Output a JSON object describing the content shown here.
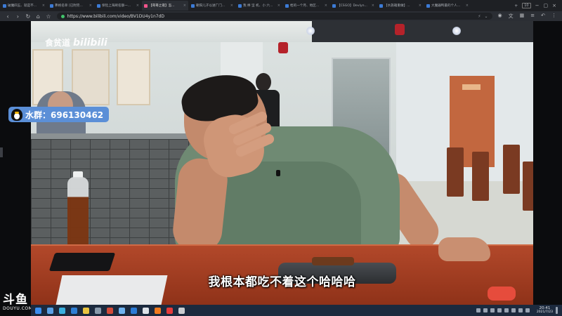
{
  "browser": {
    "tabs": [
      {
        "title": "破魔四五、就是不..."
      },
      {
        "title": "弗格名单 [已附完..."
      },
      {
        "title": "保险上海刷名额一..."
      },
      {
        "title": "【哥哥之夜】怎..."
      },
      {
        "title": "朝阳儿子以进厂门..."
      },
      {
        "title": "我 棒 坚 机、小 六..."
      },
      {
        "title": "枪的一个月、地区..."
      },
      {
        "title": "【CSGO】Devlyn..."
      },
      {
        "title": "【水族箱重做】..."
      },
      {
        "title": "大魔器鸭最的个人..."
      }
    ],
    "tab_count": "10",
    "url": "https://www.bilibili.com/video/BV1DU4y1n7dD"
  },
  "video": {
    "watermark_channel": "食贫道",
    "watermark_logo": "bilibili",
    "subtitle": "我根本都吃不着这个哈哈哈"
  },
  "stream_overlay": {
    "fan_group_label": "水群：696130462",
    "brand_cn": "斗鱼",
    "brand_en": "DOUYU.COM"
  },
  "taskbar": {
    "time": "20:41",
    "date": "2021/7/23"
  },
  "colors": {
    "fan_group_bg": "#5b8fd7",
    "taskbar_bg": "#1c2a3e",
    "browser_bg": "#1e2024"
  }
}
